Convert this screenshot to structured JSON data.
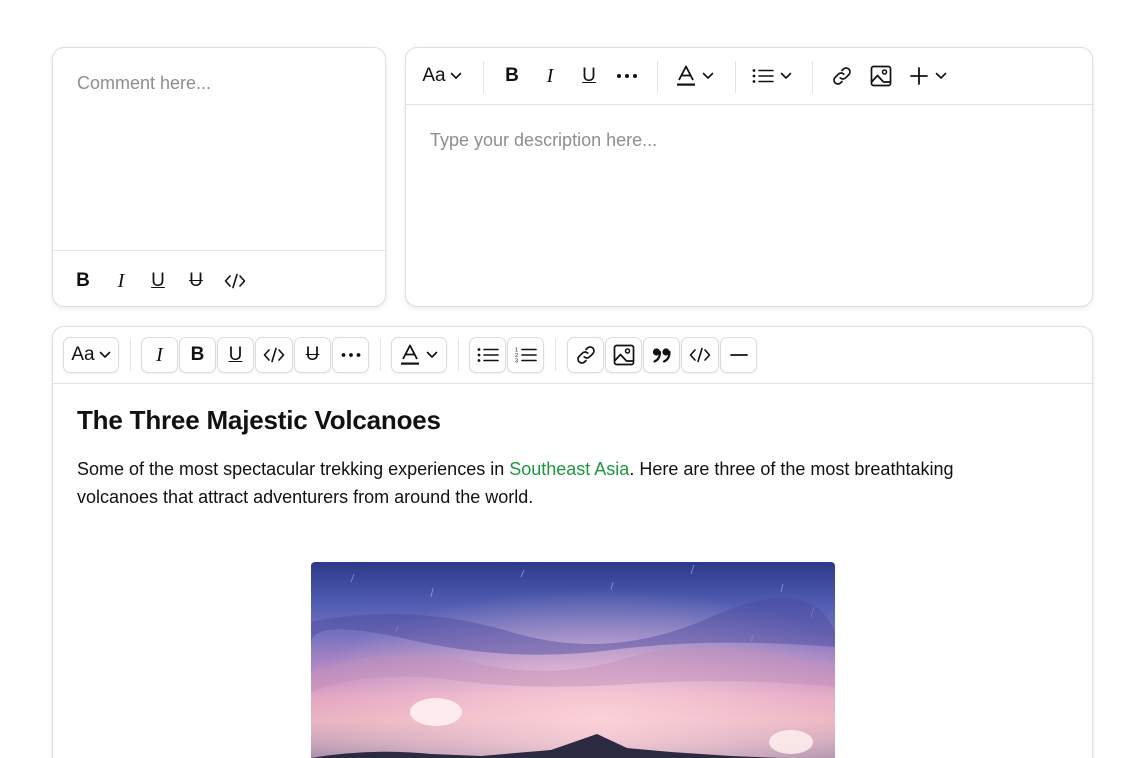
{
  "comment_box": {
    "placeholder": "Comment here...",
    "toolbar": {
      "bold": "B",
      "italic": "I",
      "underline": "U",
      "strikethrough": "U"
    }
  },
  "description_box": {
    "placeholder": "Type your description here...",
    "toolbar": {
      "font": "Aa",
      "bold": "B",
      "italic": "I",
      "underline": "U"
    }
  },
  "main_editor": {
    "toolbar": {
      "font": "Aa",
      "italic": "I",
      "bold": "B",
      "underline": "U",
      "strikethrough": "U"
    },
    "document": {
      "title": "The Three Majestic Volcanoes",
      "para_before": "Some of the most spectacular trekking experiences in ",
      "para_link": "Southeast Asia",
      "para_after": ". Here are three of the most breathtaking volcanoes that attract adventurers from around the world."
    }
  },
  "colors": {
    "link_green": "#1a9a3e",
    "placeholder_gray": "#8e8e8e",
    "border": "#dedede"
  }
}
